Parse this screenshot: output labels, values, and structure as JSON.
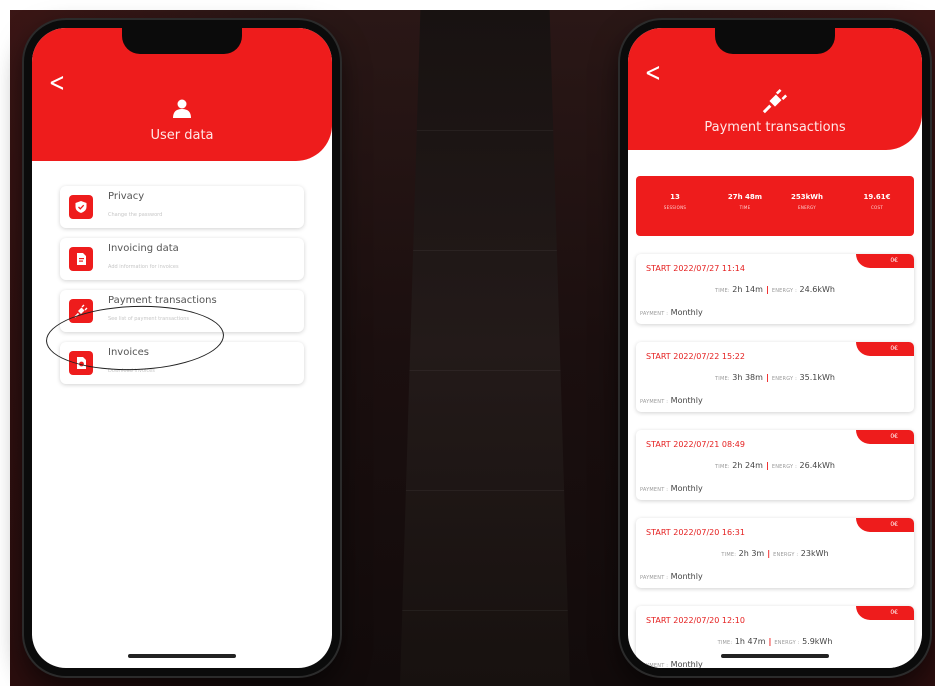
{
  "left_screen": {
    "header_title": "User data",
    "menu": [
      {
        "title": "Privacy",
        "subtitle": "Change the password",
        "icon": "shield-icon"
      },
      {
        "title": "Invoicing data",
        "subtitle": "Add information for invoices",
        "icon": "document-edit-icon"
      },
      {
        "title": "Payment transactions",
        "subtitle": "See list of payment transactions",
        "icon": "plug-icon"
      },
      {
        "title": "Invoices",
        "subtitle": "Download invoices",
        "icon": "invoice-icon"
      }
    ]
  },
  "right_screen": {
    "header_title": "Payment transactions",
    "stats": [
      {
        "value": "13",
        "label": "SESSIONS"
      },
      {
        "value": "27h 48m",
        "label": "TIME"
      },
      {
        "value": "253kWh",
        "label": "ENERGY"
      },
      {
        "value": "19.61€",
        "label": "COST"
      }
    ],
    "labels": {
      "time": "TIME:",
      "energy": "ENERGY :",
      "payment": "PAYMENT :",
      "separator": "|"
    },
    "transactions": [
      {
        "start": "START 2022/07/27 11:14",
        "cost": "0€",
        "time": "2h 14m",
        "energy": "24.6kWh",
        "payment": "Monthly"
      },
      {
        "start": "START 2022/07/22 15:22",
        "cost": "0€",
        "time": "3h 38m",
        "energy": "35.1kWh",
        "payment": "Monthly"
      },
      {
        "start": "START 2022/07/21 08:49",
        "cost": "0€",
        "time": "2h 24m",
        "energy": "26.4kWh",
        "payment": "Monthly"
      },
      {
        "start": "START 2022/07/20 16:31",
        "cost": "0€",
        "time": "2h 3m",
        "energy": "23kWh",
        "payment": "Monthly"
      },
      {
        "start": "START 2022/07/20 12:10",
        "cost": "0€",
        "time": "1h 47m",
        "energy": "5.9kWh",
        "payment": "Monthly"
      }
    ]
  },
  "colors": {
    "accent": "#ee1c1c",
    "background": "#1b0f0f"
  }
}
